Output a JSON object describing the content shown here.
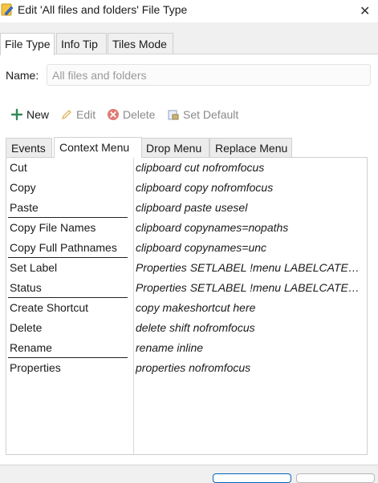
{
  "window": {
    "title": "Edit 'All files and folders' File Type",
    "app_icon": "pencil-file-icon",
    "close_icon": "close-icon"
  },
  "tabs": [
    "File Type",
    "Info Tip",
    "Tiles Mode"
  ],
  "active_tab": "File Type",
  "name_field": {
    "label": "Name:",
    "placeholder": "All files and folders",
    "value": ""
  },
  "toolbar": {
    "new": {
      "label": "New",
      "icon": "plus-icon",
      "enabled": true
    },
    "edit": {
      "label": "Edit",
      "icon": "pencil-icon",
      "enabled": false
    },
    "delete": {
      "label": "Delete",
      "icon": "delete-icon",
      "enabled": false
    },
    "set_default": {
      "label": "Set Default",
      "icon": "set-default-icon",
      "enabled": false
    }
  },
  "inner_tabs": [
    "Events",
    "Context Menu",
    "Drop Menu",
    "Replace Menu"
  ],
  "active_inner_tab": "Context Menu",
  "menu_items": [
    {
      "name": "Cut",
      "command": "clipboard cut nofromfocus"
    },
    {
      "name": "Copy",
      "command": "clipboard copy nofromfocus"
    },
    {
      "name": "Paste",
      "command": "clipboard paste usesel",
      "separator_after": true
    },
    {
      "name": "Copy File Names",
      "command": "clipboard copynames=nopaths"
    },
    {
      "name": "Copy Full Pathnames",
      "command": "clipboard copynames=unc",
      "separator_after": true
    },
    {
      "name": "Set Label",
      "command": "Properties SETLABEL !menu LABELCATEGO..."
    },
    {
      "name": "Status",
      "command": "Properties SETLABEL !menu LABELCATEGO...",
      "separator_after": true
    },
    {
      "name": "Create Shortcut",
      "command": "copy makeshortcut here"
    },
    {
      "name": "Delete",
      "command": "delete shift nofromfocus"
    },
    {
      "name": "Rename",
      "command": "rename inline",
      "separator_after": true
    },
    {
      "name": "Properties",
      "command": "properties nofromfocus"
    }
  ],
  "colors": {
    "accent": "#0067c0",
    "new_icon": "#2e8b57",
    "delete_icon": "#e07a74"
  }
}
